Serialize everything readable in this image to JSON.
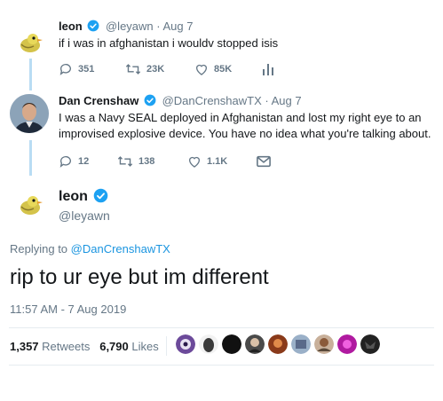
{
  "tweet1": {
    "name": "leon",
    "handle": "@leyawn",
    "date": "Aug 7",
    "text": "if i was in afghanistan i wouldv stopped isis",
    "replies": "351",
    "retweets": "23K",
    "likes": "85K"
  },
  "tweet2": {
    "name": "Dan Crenshaw",
    "handle": "@DanCrenshawTX",
    "date": "Aug 7",
    "text": "I was a Navy SEAL deployed in Afghanistan and lost my right eye to an improvised explosive device. You have no idea what you're talking about.",
    "replies": "12",
    "retweets": "138",
    "likes": "1.1K"
  },
  "main": {
    "name": "leon",
    "handle": "@leyawn",
    "replying_prefix": "Replying to",
    "replying_to": "@DanCrenshawTX",
    "text": "rip to ur eye but im different",
    "timestamp": "11:57 AM - 7 Aug 2019",
    "retweets_count": "1,357",
    "retweets_label": "Retweets",
    "likes_count": "6,790",
    "likes_label": "Likes"
  },
  "colors": {
    "accent": "#1da1f2",
    "thread": "#b9dcf3",
    "muted": "#657786"
  },
  "icons": [
    "verified-badge-icon",
    "reply-icon",
    "retweet-icon",
    "like-icon",
    "analytics-icon",
    "message-icon"
  ]
}
